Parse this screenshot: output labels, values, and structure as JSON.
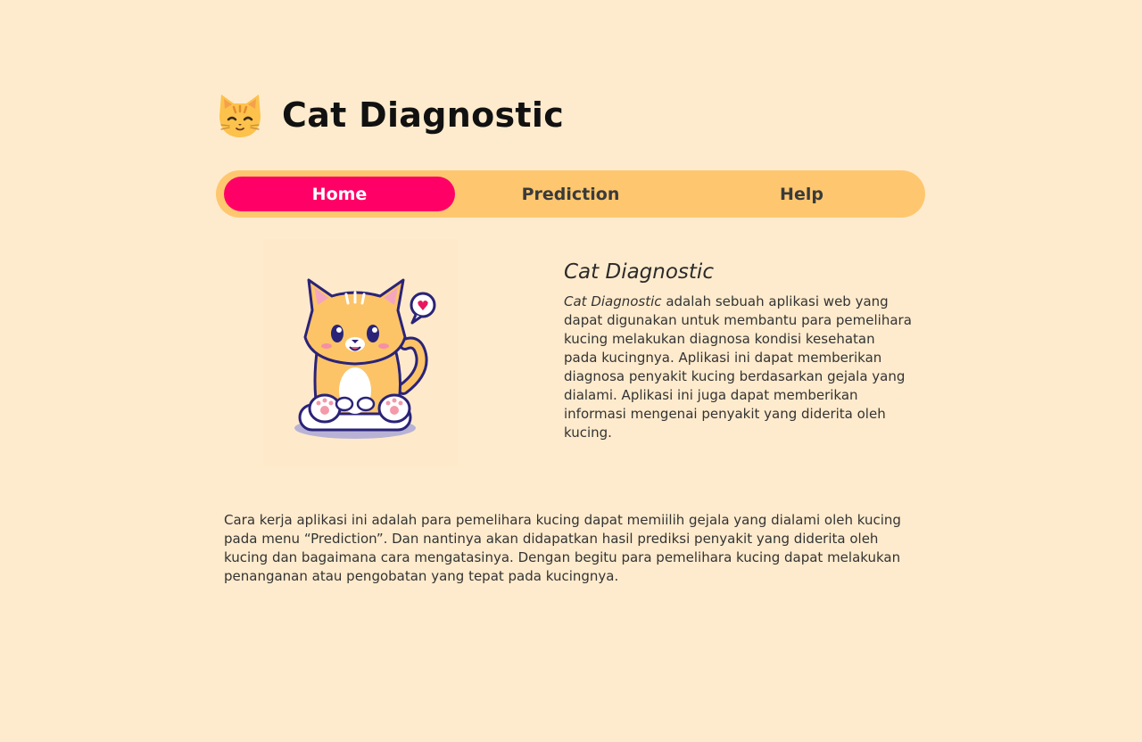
{
  "header": {
    "logo_icon": "cat-face-emoji-icon",
    "title": "Cat Diagnostic"
  },
  "nav": {
    "tabs": [
      {
        "label": "Home",
        "active": true
      },
      {
        "label": "Prediction",
        "active": false
      },
      {
        "label": "Help",
        "active": false
      }
    ]
  },
  "colors": {
    "background": "#feebcd",
    "nav_background": "#fec76f",
    "active_tab": "#ff0066",
    "active_tab_text": "#ffffff"
  },
  "hero": {
    "image_icon": "cute-cat-illustration"
  },
  "intro": {
    "title": "Cat Diagnostic",
    "body_emphasis": "Cat Diagnostic",
    "body_rest": " adalah sebuah aplikasi web yang dapat digunakan untuk membantu para pemelihara kucing melakukan diagnosa kondisi kesehatan pada kucingnya. Aplikasi ini dapat memberikan diagnosa penyakit kucing berdasarkan gejala yang dialami. Aplikasi ini juga dapat memberikan informasi mengenai penyakit yang diderita oleh kucing."
  },
  "howto": {
    "text": "Cara kerja aplikasi ini adalah para pemelihara kucing dapat memiilih gejala yang dialami oleh kucing pada menu “Prediction”. Dan nantinya akan didapatkan hasil prediksi penyakit yang diderita oleh kucing dan bagaimana cara mengatasinya. Dengan begitu para pemelihara kucing dapat melakukan penanganan atau pengobatan yang tepat pada kucingnya."
  }
}
